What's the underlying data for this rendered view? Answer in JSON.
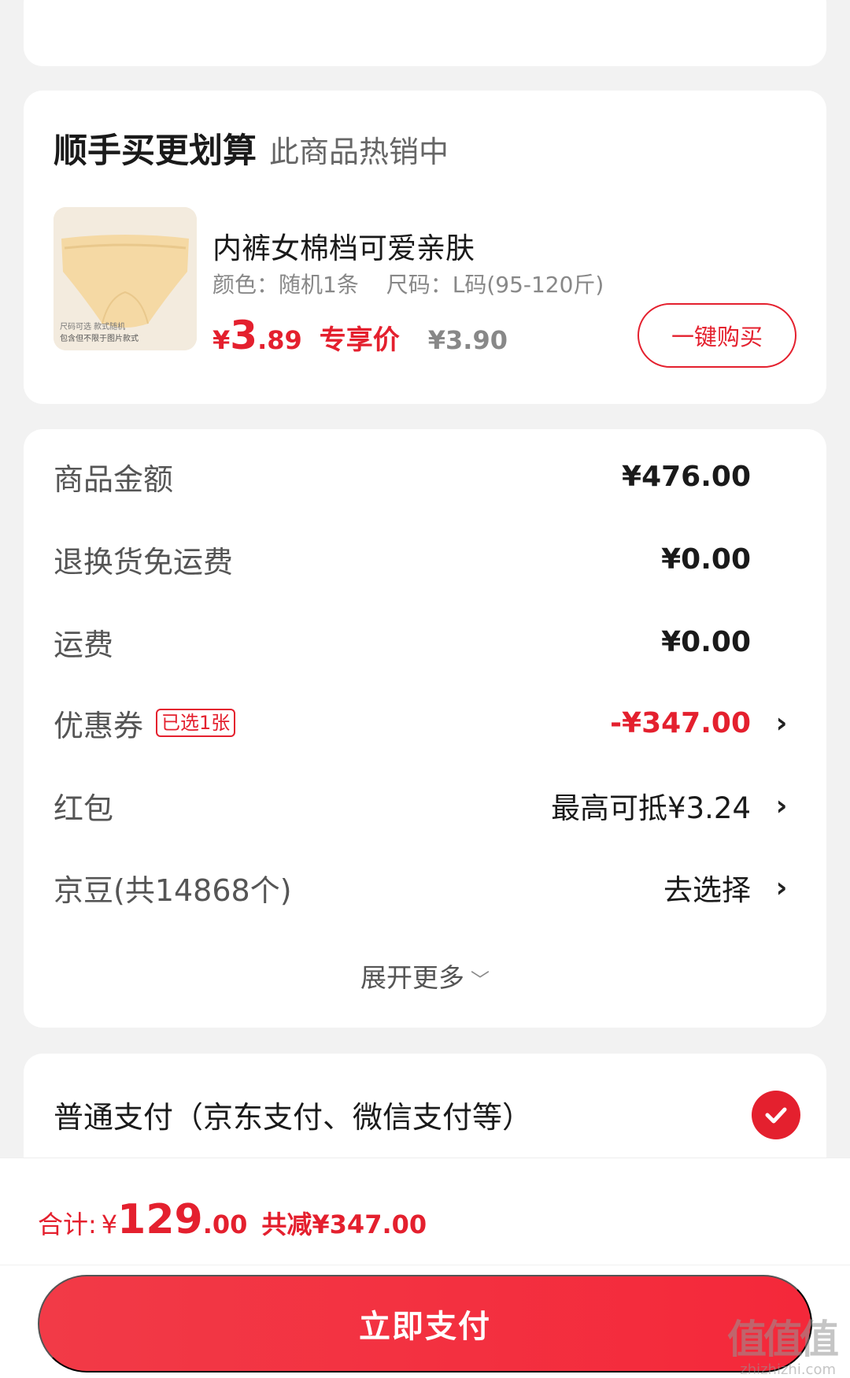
{
  "upsell": {
    "title": "顺手买更划算",
    "subtitle": "此商品热销中",
    "product": {
      "name": "内裤女棉档可爱亲肤",
      "color": "颜色：随机1条",
      "size": "尺码：L码(95-120斤)",
      "price_yen": "¥",
      "price_int": "3",
      "price_dec": ".89",
      "price_tag": "专享价",
      "original_price": "¥3.90",
      "image_caption_1": "尺码可选 款式随机",
      "image_caption_2": "包含但不限于图片款式"
    },
    "buy_button": "一键购买"
  },
  "summary": {
    "rows": [
      {
        "label": "商品金额",
        "value": "¥476.00"
      },
      {
        "label": "退换货免运费",
        "value": "¥0.00"
      },
      {
        "label": "运费",
        "value": "¥0.00"
      },
      {
        "label": "优惠券",
        "badge": "已选1张",
        "value": "-¥347.00"
      },
      {
        "label": "红包",
        "value": "最高可抵¥3.24"
      },
      {
        "label": "京豆(共14868个)",
        "value": "去选择"
      }
    ],
    "expand": "展开更多"
  },
  "payment": {
    "method": "普通支付（京东支付、微信支付等）"
  },
  "footer": {
    "total_label": "合计:",
    "total_yen": "¥",
    "total_int": "129",
    "total_dec": ".00",
    "saved": "共减¥347.00",
    "pay_button": "立即支付",
    "watermark_logo": "值值值",
    "watermark_url": "zhizhizhi.com"
  },
  "colors": {
    "accent": "#e4202e",
    "background": "#f2f2f2"
  }
}
